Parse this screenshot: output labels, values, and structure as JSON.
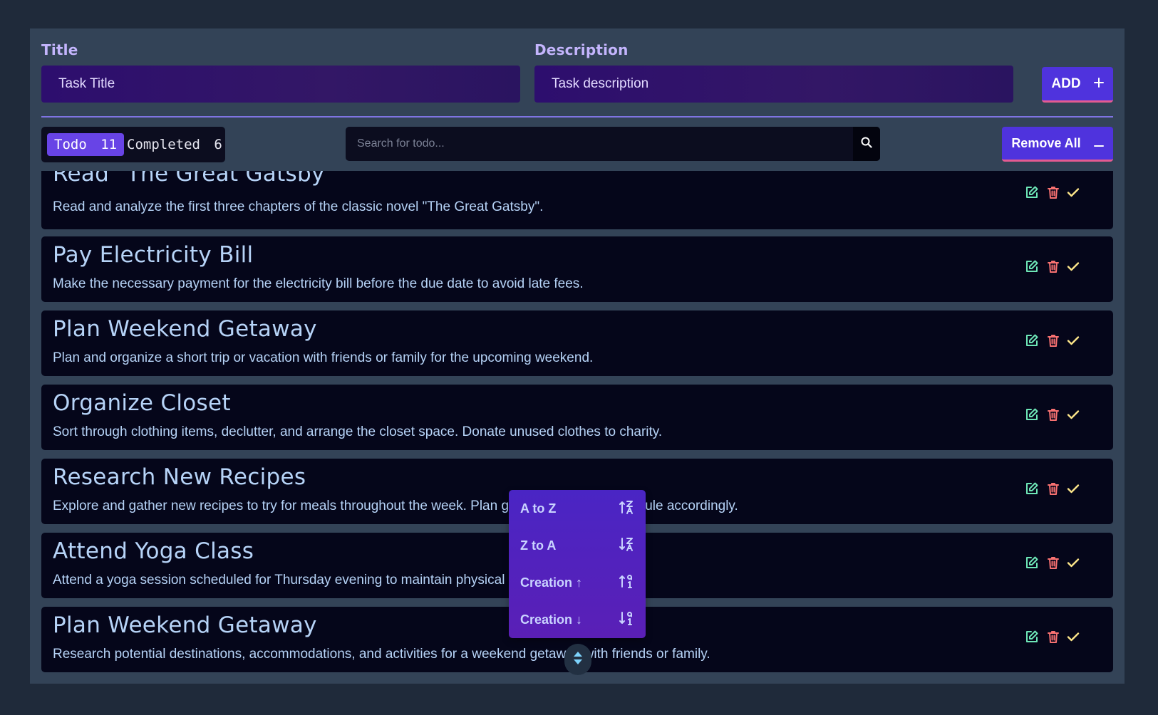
{
  "form": {
    "title_label": "Title",
    "title_placeholder": "Task Title",
    "description_label": "Description",
    "description_placeholder": "Task description",
    "add_label": "ADD"
  },
  "tabs": {
    "todo": {
      "label": "Todo",
      "count": "11"
    },
    "completed": {
      "label": "Completed",
      "count": "6"
    }
  },
  "search": {
    "placeholder": "Search for todo..."
  },
  "remove_all_label": "Remove All",
  "todos": [
    {
      "title": "Read \"The Great Gatsby\"",
      "description": "Read and analyze the first three chapters of the classic novel \"The Great Gatsby\"."
    },
    {
      "title": "Pay Electricity Bill",
      "description": "Make the necessary payment for the electricity bill before the due date to avoid late fees."
    },
    {
      "title": "Plan Weekend Getaway",
      "description": "Plan and organize a short trip or vacation with friends or family for the upcoming weekend."
    },
    {
      "title": "Organize Closet",
      "description": "Sort through clothing items, declutter, and arrange the closet space. Donate unused clothes to charity."
    },
    {
      "title": "Research New Recipes",
      "description": "Explore and gather new recipes to try for meals throughout the week. Plan grocery shopping schedule accordingly."
    },
    {
      "title": "Attend Yoga Class",
      "description": "Attend a yoga session scheduled for Thursday evening to maintain physical fitness and well-being."
    },
    {
      "title": "Plan Weekend Getaway",
      "description": "Research potential destinations, accommodations, and activities for a weekend getaway with friends or family."
    }
  ],
  "sort_menu": [
    {
      "label": "A to Z",
      "icon": "sort-alpha-up-icon"
    },
    {
      "label": "Z to A",
      "icon": "sort-alpha-down-icon"
    },
    {
      "label": "Creation ↑",
      "icon": "sort-numeric-up-icon"
    },
    {
      "label": "Creation ↓",
      "icon": "sort-numeric-down-icon"
    }
  ],
  "colors": {
    "background": "#1f2a3a",
    "panel": "#334357",
    "accent": "#4f33dd",
    "accent_underline": "#e45b91",
    "card": "#05061a",
    "card_text": "#b6d3f7",
    "edit_icon": "#6ee7b7",
    "delete_icon": "#f87171",
    "check_icon": "#fde68a"
  }
}
